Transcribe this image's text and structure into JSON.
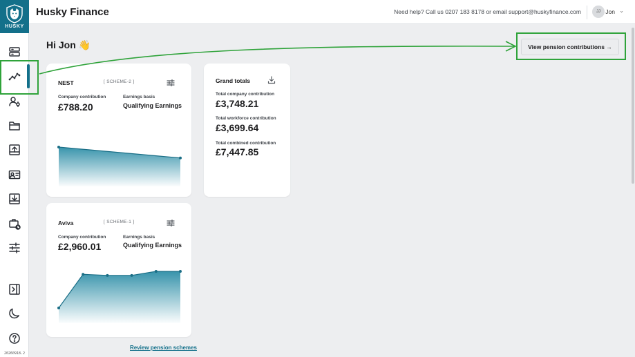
{
  "app": {
    "title": "Husky Finance",
    "logo_text": "HUSKY",
    "version": "20260918.2"
  },
  "header": {
    "help_text": "Need help? Call us 0207 183 8178 or email support@huskyfinance.com",
    "user_initials": "JJ",
    "user_name": "Jon"
  },
  "greeting": "Hi Jon 👋",
  "view_button_label": "View pension contributions →",
  "sidebar": {
    "items": [
      {
        "icon": "server-icon"
      },
      {
        "icon": "trend-chart-icon",
        "active": true
      },
      {
        "icon": "user-settings-icon"
      },
      {
        "icon": "folder-icon"
      },
      {
        "icon": "upload-icon"
      },
      {
        "icon": "id-card-icon"
      },
      {
        "icon": "download-icon"
      },
      {
        "icon": "briefcase-clock-icon"
      },
      {
        "icon": "sliders-icon"
      }
    ],
    "bottom": [
      {
        "icon": "panel-toggle-icon"
      },
      {
        "icon": "moon-icon"
      },
      {
        "icon": "help-icon"
      }
    ]
  },
  "schemes": [
    {
      "name": "NEST",
      "tag": "[ SCHEME-2 ]",
      "company_label": "Company contribution",
      "company_value": "£788.20",
      "basis_label": "Earnings basis",
      "basis_value": "Qualifying Earnings",
      "trend": [
        1.0,
        0.55
      ]
    },
    {
      "name": "Aviva",
      "tag": "[ SCHEME-1 ]",
      "company_label": "Company contribution",
      "company_value": "£2,960.01",
      "basis_label": "Earnings basis",
      "basis_value": "Qualifying Earnings",
      "trend": [
        0.0,
        0.92,
        0.89,
        0.89,
        1.0,
        1.0
      ]
    }
  ],
  "grand_totals": {
    "title": "Grand totals",
    "company_label": "Total company contribution",
    "company_value": "£3,748.21",
    "workforce_label": "Total workforce contribution",
    "workforce_value": "£3,699.64",
    "combined_label": "Total combined contribution",
    "combined_value": "£7,447.85"
  },
  "review_link": "Review pension schemes",
  "colors": {
    "brand": "#13708a",
    "highlight": "#2fa33a"
  }
}
